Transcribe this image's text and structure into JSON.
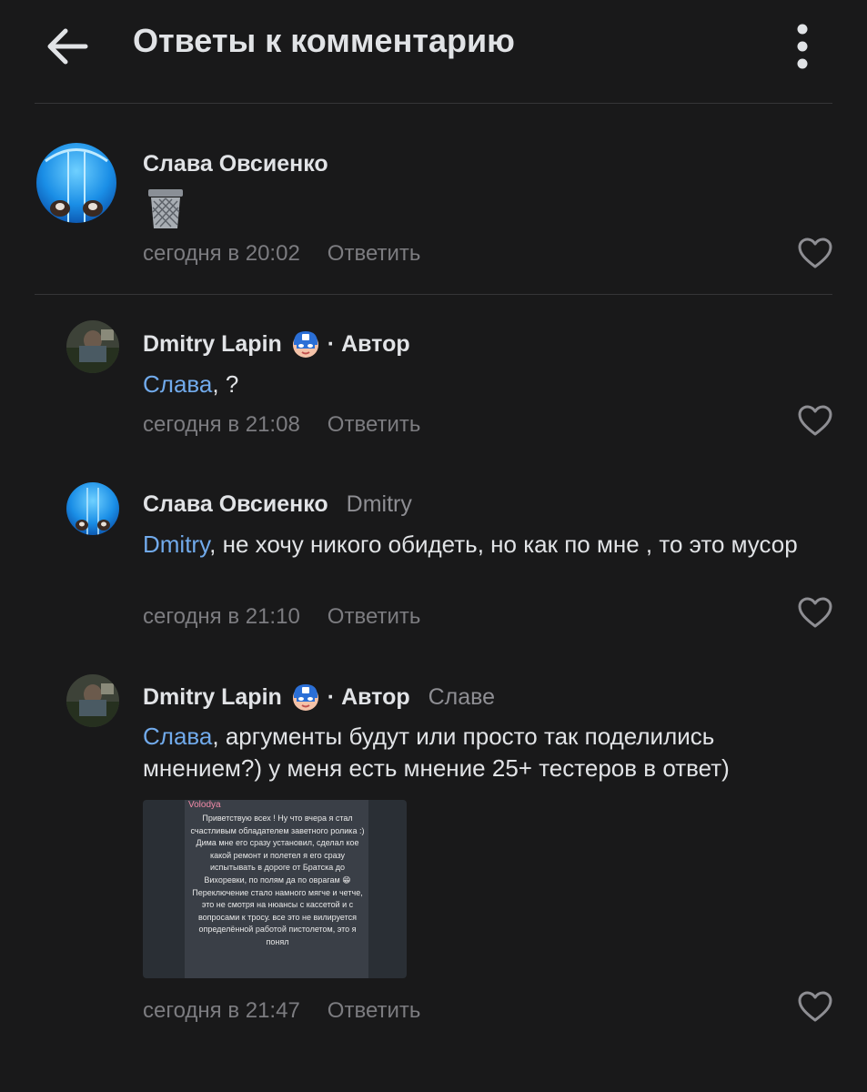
{
  "header": {
    "title": "Ответы к комментарию",
    "back_icon": "arrow-left-icon",
    "more_icon": "more-vertical-icon"
  },
  "comments": [
    {
      "author": "Слава Овсиенко",
      "emoji": "trash-can-emoji",
      "time": "сегодня в 20:02",
      "reply_label": "Ответить"
    },
    {
      "author": "Dmitry Lapin",
      "author_tag": "· Автор",
      "mention": "Слава",
      "text_rest": ", ?",
      "time": "сегодня в 21:08",
      "reply_label": "Ответить"
    },
    {
      "author": "Слава Овсиенко",
      "reply_to": "Dmitry",
      "mention": "Dmitry",
      "text_rest": ", не хочу никого обидеть, но как по мне , то это мусор",
      "time": "сегодня в 21:10",
      "reply_label": "Ответить"
    },
    {
      "author": "Dmitry Lapin",
      "author_tag": "· Автор",
      "reply_to": "Славе",
      "mention": "Слава",
      "text_rest": ", аргументы будут или просто так поделились мнением?) у меня есть мнение 25+ тестеров в ответ)",
      "attachment": {
        "sender": "Volodya",
        "text": "Приветствую всех ! Ну что вчера я стал счастливым обладателем заветного ролика :) Дима мне его сразу установил, сделал кое какой ремонт и полетел я его сразу испытывать в дороге от Братска до Вихоревки, по полям да по оврагам 😁 Переключение стало намного мягче и четче, это не смотря на нюансы с кассетой и с вопросами к тросу. все это не вилируется определённой работой пистолетом, это я понял"
      },
      "time": "сегодня в 21:47",
      "reply_label": "Ответить"
    }
  ],
  "colors": {
    "background": "#19191a",
    "accent": "#71aaeb",
    "text": "#e1e3e6",
    "secondary": "#7c7c80"
  }
}
